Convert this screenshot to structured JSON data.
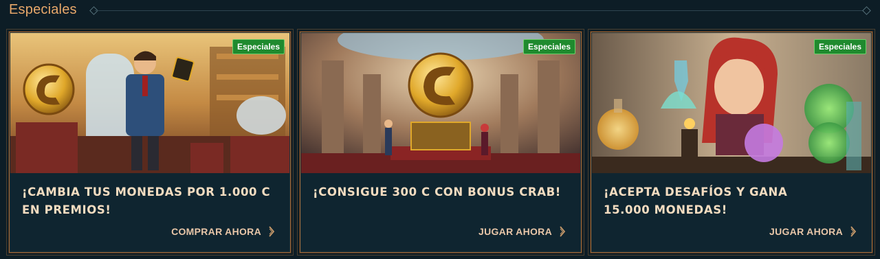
{
  "section": {
    "title": "Especiales"
  },
  "cards": [
    {
      "badge": "Especiales",
      "title_line1": "¡CAMBIA TUS MONEDAS POR 1.000 C",
      "title_line2": "EN PREMIOS!",
      "cta": "COMPRAR AHORA"
    },
    {
      "badge": "Especiales",
      "title_line1": "¡CONSIGUE 300 C CON BONUS CRAB!",
      "title_line2": "",
      "cta": "JUGAR AHORA"
    },
    {
      "badge": "Especiales",
      "title_line1": "¡ACEPTA DESAFÍOS Y GANA",
      "title_line2": "15.000 MONEDAS!",
      "cta": "JUGAR AHORA"
    }
  ],
  "colors": {
    "accent": "#e8a86a",
    "badge_green": "#1f8a2e",
    "card_bg": "#0f2530",
    "page_bg": "#0d1d26"
  },
  "icons": {
    "cta": "chevron-right-icon",
    "coin": "coin-icon"
  }
}
